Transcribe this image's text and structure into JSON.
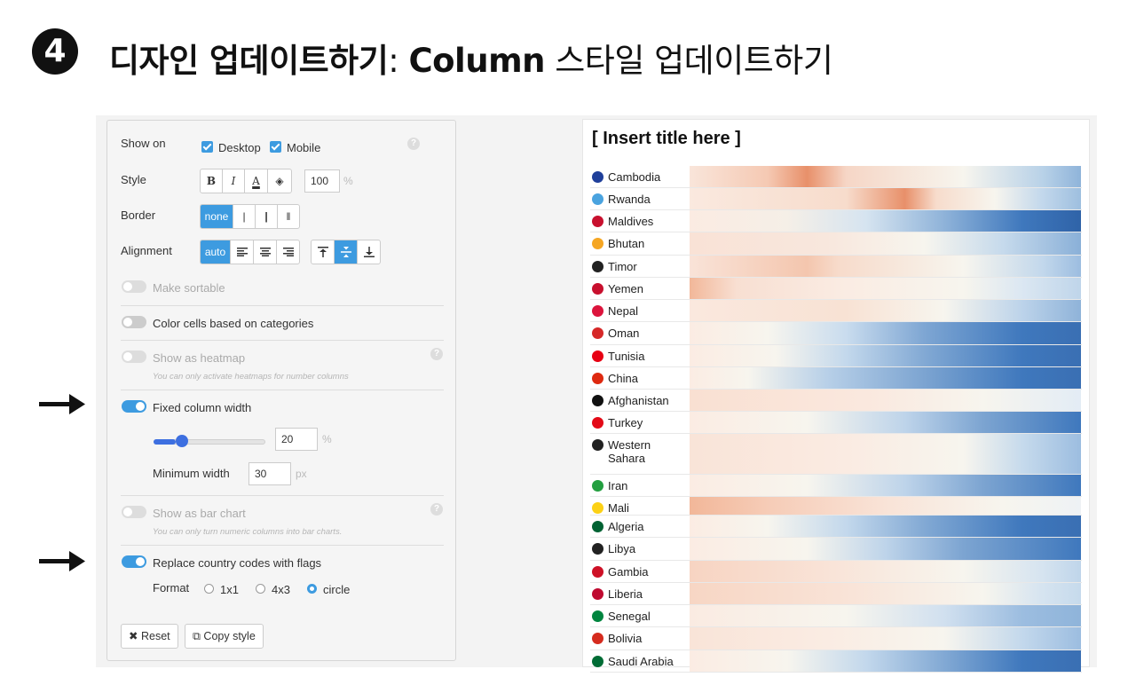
{
  "header": {
    "step": "4",
    "title_bold": "디자인 업데이트하기",
    "title_colon": ":",
    "title_column": "Column",
    "title_rest": "스타일 업데이트하기"
  },
  "panel": {
    "show_on_label": "Show on",
    "desktop_label": "Desktop",
    "mobile_label": "Mobile",
    "style_label": "Style",
    "style_buttons": [
      "B",
      "I",
      "A",
      "◈"
    ],
    "size_value": "100",
    "size_unit": "%",
    "border_label": "Border",
    "border_options": [
      "none",
      "|",
      "|",
      "‖"
    ],
    "alignment_label": "Alignment",
    "align_auto": "auto",
    "make_sortable": "Make sortable",
    "color_cells": "Color cells based on categories",
    "show_heatmap": "Show as heatmap",
    "heatmap_hint": "You can only activate heatmaps for number columns",
    "fixed_width": "Fixed column width",
    "width_value": "20",
    "width_unit": "%",
    "width_fraction": 0.2,
    "min_width_label": "Minimum width",
    "min_width_value": "30",
    "min_width_unit": "px",
    "bar_chart": "Show as bar chart",
    "bar_hint": "You can only turn numeric columns into bar charts.",
    "replace_flags": "Replace country codes with flags",
    "format_label": "Format",
    "format_options": [
      "1x1",
      "4x3",
      "circle"
    ],
    "format_selected": "circle",
    "reset_label": "Reset",
    "copy_label": "Copy style",
    "help": "?"
  },
  "table": {
    "title": "[ Insert title here ]",
    "rows": [
      {
        "country": "Cambodia",
        "flag": "#1f3f9a"
      },
      {
        "country": "Rwanda",
        "flag": "#4aa3df"
      },
      {
        "country": "Maldives",
        "flag": "#c8102e"
      },
      {
        "country": "Bhutan",
        "flag": "#f5a623"
      },
      {
        "country": "Timor",
        "flag": "#222222"
      },
      {
        "country": "Yemen",
        "flag": "#c8102e"
      },
      {
        "country": "Nepal",
        "flag": "#dc143c"
      },
      {
        "country": "Oman",
        "flag": "#d62828"
      },
      {
        "country": "Tunisia",
        "flag": "#e70013"
      },
      {
        "country": "China",
        "flag": "#de2910"
      },
      {
        "country": "Afghanistan",
        "flag": "#111111"
      },
      {
        "country": "Turkey",
        "flag": "#e30a17"
      },
      {
        "country": "Western Sahara",
        "flag": "#222222"
      },
      {
        "country": "Iran",
        "flag": "#239f40"
      },
      {
        "country": "Mali",
        "flag": "#fcd116"
      },
      {
        "country": "Algeria",
        "flag": "#006233"
      },
      {
        "country": "Libya",
        "flag": "#222222"
      },
      {
        "country": "Gambia",
        "flag": "#ce1126"
      },
      {
        "country": "Liberia",
        "flag": "#bf0a30"
      },
      {
        "country": "Senegal",
        "flag": "#00853f"
      },
      {
        "country": "Bolivia",
        "flag": "#d52b1e"
      },
      {
        "country": "Saudi Arabia",
        "flag": "#006c35"
      }
    ]
  },
  "colors": {
    "accent": "#3d9be0",
    "heat_warm": "#e8906a",
    "heat_neutral": "#f7f5ee",
    "heat_cool": "#3f78bd"
  }
}
